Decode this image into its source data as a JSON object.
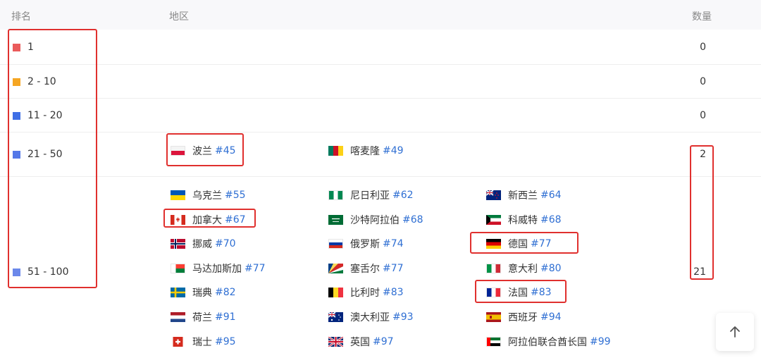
{
  "header": {
    "rank_label": "排名",
    "region_label": "地区",
    "count_label": "数量"
  },
  "rows": [
    {
      "range": "1",
      "color": "#ea5b5b",
      "count": "0"
    },
    {
      "range": "2 - 10",
      "color": "#f5a623",
      "count": "0"
    },
    {
      "range": "11 - 20",
      "color": "#3f6fe6",
      "count": "0"
    },
    {
      "range": "21 - 50",
      "color": "#5478e8",
      "count": "2"
    },
    {
      "range": "51 - 100",
      "color": "#6b88ea",
      "count": "21"
    }
  ],
  "countries": [
    {
      "name": "波兰",
      "rank": "#45",
      "flag": "poland"
    },
    {
      "name": "喀麦隆",
      "rank": "#49",
      "flag": "cameroon"
    },
    {
      "name": "乌克兰",
      "rank": "#55",
      "flag": "ukraine"
    },
    {
      "name": "尼日利亚",
      "rank": "#62",
      "flag": "nigeria"
    },
    {
      "name": "新西兰",
      "rank": "#64",
      "flag": "new-zealand"
    },
    {
      "name": "加拿大",
      "rank": "#67",
      "flag": "canada"
    },
    {
      "name": "沙特阿拉伯",
      "rank": "#68",
      "flag": "saudi-arabia"
    },
    {
      "name": "科威特",
      "rank": "#68",
      "flag": "kuwait"
    },
    {
      "name": "挪威",
      "rank": "#70",
      "flag": "norway"
    },
    {
      "name": "俄罗斯",
      "rank": "#74",
      "flag": "russia"
    },
    {
      "name": "德国",
      "rank": "#77",
      "flag": "germany"
    },
    {
      "name": "马达加斯加",
      "rank": "#77",
      "flag": "madagascar"
    },
    {
      "name": "塞舌尔",
      "rank": "#77",
      "flag": "seychelles"
    },
    {
      "name": "意大利",
      "rank": "#80",
      "flag": "italy"
    },
    {
      "name": "瑞典",
      "rank": "#82",
      "flag": "sweden"
    },
    {
      "name": "比利时",
      "rank": "#83",
      "flag": "belgium"
    },
    {
      "name": "法国",
      "rank": "#83",
      "flag": "france"
    },
    {
      "name": "荷兰",
      "rank": "#91",
      "flag": "netherlands"
    },
    {
      "name": "澳大利亚",
      "rank": "#93",
      "flag": "australia"
    },
    {
      "name": "西班牙",
      "rank": "#94",
      "flag": "spain"
    },
    {
      "name": "瑞士",
      "rank": "#95",
      "flag": "switzerland"
    },
    {
      "name": "英国",
      "rank": "#97",
      "flag": "uk"
    },
    {
      "name": "阿拉伯联合酋长国",
      "rank": "#99",
      "flag": "uae"
    }
  ],
  "highlight_color": "#e0302e",
  "back_to_top_icon": "arrow-up-icon"
}
